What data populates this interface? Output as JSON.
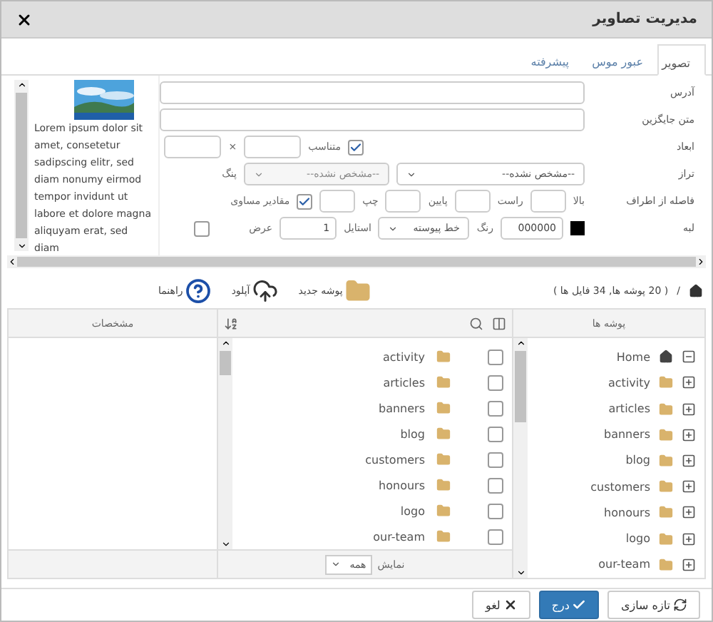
{
  "window": {
    "title": "مدیریت تصاویر"
  },
  "tabs": [
    {
      "label": "تصویر",
      "selected": true
    },
    {
      "label": "عبور موس",
      "selected": false
    },
    {
      "label": "پیشرفته",
      "selected": false
    }
  ],
  "preview": {
    "text": "Lorem ipsum dolor sit amet, consetetur sadipscing elitr, sed diam nonumy eirmod tempor invidunt ut labore et dolore magna aliquyam erat, sed diam"
  },
  "form": {
    "url": {
      "label": "آدرس"
    },
    "alt": {
      "label": "متن جایگزین"
    },
    "size": {
      "label": "ابعاد",
      "separator": "×",
      "lock": {
        "label": "متناسب",
        "checked": true
      }
    },
    "align": {
      "label": "تراز",
      "value": "--مشخص نشده--",
      "float": {
        "label": "پنگ",
        "value": "--مشخص نشده--",
        "disabled": true
      }
    },
    "spacing": {
      "label": "فاصله از اطراف",
      "sides": [
        {
          "label": "بالا"
        },
        {
          "label": "راست"
        },
        {
          "label": "پایین"
        },
        {
          "label": "چپ"
        }
      ],
      "equal": {
        "label": "مقادیر مساوی",
        "checked": true
      }
    },
    "border": {
      "label": "لبه",
      "color": {
        "value": "000000",
        "label": "رنگ"
      },
      "style": {
        "value": "خط پیوسته",
        "label": "استایل"
      },
      "width": {
        "value": "1",
        "label": "عرض"
      },
      "enabled": {
        "checked": false
      }
    }
  },
  "file_manager": {
    "separator": "/",
    "count": "( 20 پوشه ها, 34 فایل ها )",
    "toolbar": [
      {
        "label": "پوشه جدید",
        "kind": "new-folder"
      },
      {
        "label": "آپلود",
        "kind": "upload"
      },
      {
        "label": "راهنما",
        "kind": "help"
      }
    ],
    "tree": {
      "header": "پوشه ها",
      "root": {
        "label": "Home",
        "expanded": true,
        "children": [
          {
            "label": "activity",
            "expanded": false
          },
          {
            "label": "articles",
            "expanded": false
          },
          {
            "label": "banners",
            "expanded": false
          },
          {
            "label": "blog",
            "expanded": false
          },
          {
            "label": "customers",
            "expanded": false
          },
          {
            "label": "honours",
            "expanded": false
          },
          {
            "label": "logo",
            "expanded": false
          },
          {
            "label": "our-team",
            "expanded": false
          }
        ]
      }
    },
    "list": {
      "items": [
        {
          "label": "activity",
          "checked": false
        },
        {
          "label": "articles",
          "checked": false
        },
        {
          "label": "banners",
          "checked": false
        },
        {
          "label": "blog",
          "checked": false
        },
        {
          "label": "customers",
          "checked": false
        },
        {
          "label": "honours",
          "checked": false
        },
        {
          "label": "logo",
          "checked": false
        },
        {
          "label": "our-team",
          "checked": false
        }
      ],
      "show_label": "نمایش",
      "show_value": "همه"
    },
    "details": {
      "header": "مشخصات"
    }
  },
  "buttons": [
    {
      "label": "تازه سازی",
      "kind": "refresh"
    },
    {
      "label": "درج",
      "kind": "insert"
    },
    {
      "label": "لغو",
      "kind": "cancel"
    }
  ]
}
